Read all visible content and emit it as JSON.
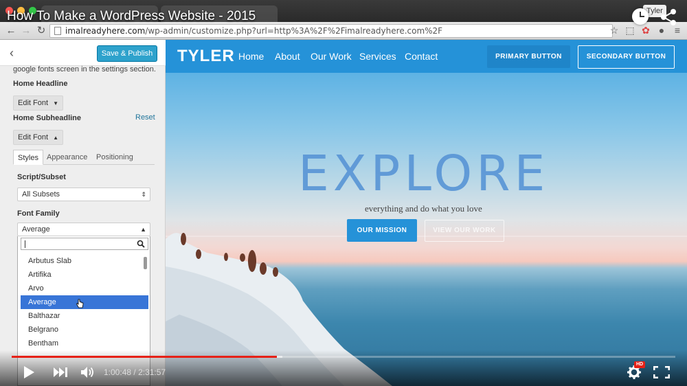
{
  "video": {
    "title": "How To Make a WordPress Website - 2015",
    "current_time": "1:00:48",
    "duration": "2:31:57",
    "time_separator": " / ",
    "progress_played": 0.4,
    "progress_buffered": 0.408,
    "user_label": "Tyler",
    "hd_label": "HD"
  },
  "browser": {
    "url_host": "imalreadyhere.com",
    "url_path": "/wp-admin/customize.php?url=http%3A%2F%2Fimalreadyhere.com%2F"
  },
  "sidebar": {
    "publish_label": "Save & Publish",
    "intro_text": "google fonts screen in the settings section.",
    "home_headline_label": "Home Headline",
    "edit_font_label_1": "Edit Font",
    "home_subheadline_label": "Home Subheadline",
    "reset_label": "Reset",
    "edit_font_label_2": "Edit Font",
    "tabs": [
      "Styles",
      "Appearance",
      "Positioning"
    ],
    "script_subset_label": "Script/Subset",
    "script_subset_value": "All Subsets",
    "font_family_label": "Font Family",
    "font_family_value": "Average",
    "font_options": [
      "Arbutus Slab",
      "Artifika",
      "Arvo",
      "Average",
      "Balthazar",
      "Belgrano",
      "Bentham"
    ],
    "selected_font": "Average"
  },
  "site": {
    "logo": "TYLER",
    "nav": [
      "Home",
      "About",
      "Our Work",
      "Services",
      "Contact"
    ],
    "primary_button": "PRIMARY BUTTON",
    "secondary_button": "SECONDARY BUTTON",
    "hero_title": "EXPLORE",
    "hero_subtitle": "everything and do what you love",
    "hero_button_1": "OUR MISSION",
    "hero_button_2": "VIEW OUR WORK"
  },
  "colors": {
    "wp_accent": "#2ea2cc",
    "site_blue": "#2592d8",
    "youtube_red": "#e62117",
    "selection_blue": "#3875d7"
  }
}
